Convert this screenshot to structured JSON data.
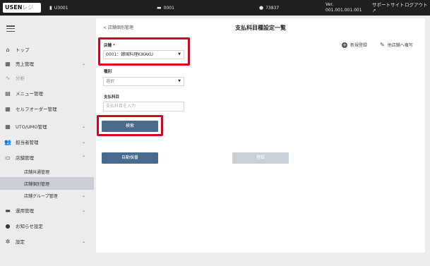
{
  "topbar": {
    "logo_main": "USEN",
    "logo_sub": "レジ",
    "store_code": "U3001",
    "terminal": "0001",
    "user": "73837",
    "version_label": "Ver.",
    "version_value": "001.001.001.001",
    "support_label": "サポートサイト",
    "logout_label": "ログアウト"
  },
  "sidebar": {
    "items": [
      {
        "label": "トップ",
        "icon": "home-icon"
      },
      {
        "label": "売上管理",
        "icon": "sales-icon"
      },
      {
        "label": "分析",
        "icon": "analytics-icon"
      },
      {
        "label": "メニュー管理",
        "icon": "menu-icon"
      },
      {
        "label": "セルフオーダー管理",
        "icon": "self-order-icon"
      },
      {
        "label": "UTO/UMO管理",
        "icon": "uto-icon"
      },
      {
        "label": "担当者管理",
        "icon": "staff-icon"
      },
      {
        "label": "店舗管理",
        "icon": "store-icon"
      },
      {
        "label": "運用管理",
        "icon": "operation-icon"
      },
      {
        "label": "お知らせ設定",
        "icon": "bell-icon"
      },
      {
        "label": "設定",
        "icon": "gear-icon"
      }
    ],
    "store_sub": [
      {
        "label": "店舗共通管理"
      },
      {
        "label": "店舗個別管理"
      },
      {
        "label": "店舗グループ管理"
      }
    ]
  },
  "main": {
    "back_link": "< 店舗個別管理",
    "title": "支払科目種設定一覧",
    "new_label": "新規登録",
    "copy_label": "他店舗へ複写",
    "store_label": "店舗",
    "store_required": "*",
    "store_value": "0001：韓国料理KIKAKU",
    "type_label": "種別",
    "type_value": "選択",
    "subject_label": "支払科目",
    "subject_placeholder": "支払科目を入力",
    "search_button": "検索",
    "auto_button": "自動採番",
    "register_button": "登録"
  },
  "colors": {
    "topbar": "#1f1f1f",
    "sidebar": "#ececec",
    "primary_button": "#486a8c",
    "disabled_button": "#c8d0d8",
    "highlight": "#e0001b"
  }
}
